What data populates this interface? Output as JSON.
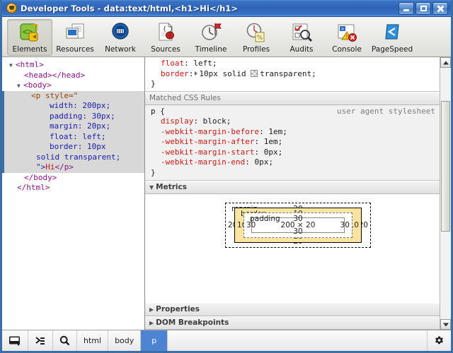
{
  "window": {
    "title": "Developer Tools - data:text/html,<h1>Hi</h1>",
    "icon": "devtools-shield-icon",
    "controls": {
      "minimize": "minimize-button",
      "maximize": "maximize-button",
      "close": "close-button"
    }
  },
  "toolbar": {
    "items": [
      {
        "label": "Elements",
        "icon": "elements-icon",
        "selected": true
      },
      {
        "label": "Resources",
        "icon": "resources-icon",
        "selected": false
      },
      {
        "label": "Network",
        "icon": "network-icon",
        "selected": false
      },
      {
        "label": "Sources",
        "icon": "sources-icon",
        "selected": false
      },
      {
        "label": "Timeline",
        "icon": "timeline-icon",
        "selected": false
      },
      {
        "label": "Profiles",
        "icon": "profiles-icon",
        "selected": false
      },
      {
        "label": "Audits",
        "icon": "audits-icon",
        "selected": false
      },
      {
        "label": "Console",
        "icon": "console-icon",
        "selected": false
      },
      {
        "label": "PageSpeed",
        "icon": "pagespeed-icon",
        "selected": false
      }
    ]
  },
  "dom_tree": {
    "rows": [
      {
        "id": "r0",
        "text": "<html>"
      },
      {
        "id": "r1",
        "text": "<head></head>"
      },
      {
        "id": "r2",
        "text": "<body>"
      },
      {
        "id": "r3",
        "text": "<p style=\""
      },
      {
        "id": "r4",
        "text": "width: 200px;"
      },
      {
        "id": "r5",
        "text": "padding: 30px;"
      },
      {
        "id": "r6",
        "text": "margin: 20px;"
      },
      {
        "id": "r7",
        "text": "float: left;"
      },
      {
        "id": "r8",
        "text": "border: 10px"
      },
      {
        "id": "r9",
        "text": "solid transparent;"
      },
      {
        "id": "r10",
        "text": "\">Hi</p>"
      },
      {
        "id": "r11",
        "text": "</body>"
      },
      {
        "id": "r12",
        "text": "</html>"
      }
    ],
    "selected_node": "p"
  },
  "style_rule": {
    "lines": [
      {
        "prop": "float",
        "value": "left;"
      },
      {
        "prop": "border",
        "value": "10px solid transparent;"
      }
    ],
    "close_brace": "}"
  },
  "matched_css_rules": {
    "header": "Matched CSS Rules",
    "selector": "p {",
    "origin": "user agent stylesheet",
    "declarations": [
      {
        "prop": "display",
        "value": "block;"
      },
      {
        "prop": "-webkit-margin-before",
        "value": "1em;"
      },
      {
        "prop": "-webkit-margin-after",
        "value": "1em;"
      },
      {
        "prop": "-webkit-margin-start",
        "value": "0px;"
      },
      {
        "prop": "-webkit-margin-end",
        "value": "0px;"
      }
    ],
    "close_brace": "}"
  },
  "metrics": {
    "header": "Metrics",
    "box_model": {
      "margin": {
        "name": "margin",
        "top": "20",
        "right": "20",
        "bottom": "20",
        "left": "20"
      },
      "border": {
        "name": "border",
        "top": "10",
        "right": "10",
        "bottom": "10",
        "left": "10"
      },
      "padding": {
        "name": "padding",
        "top": "30",
        "right": "30",
        "bottom": "30",
        "left": "30"
      },
      "content": "200 × 20"
    }
  },
  "bottom_sections": [
    {
      "label": "Properties",
      "expanded": false
    },
    {
      "label": "DOM Breakpoints",
      "expanded": false
    }
  ],
  "statusbar": {
    "dock_icon": "dock-window-icon",
    "console_icon": "console-drawer-icon",
    "search_icon": "search-icon",
    "breadcrumbs": [
      {
        "label": "html",
        "active": false
      },
      {
        "label": "body",
        "active": false
      },
      {
        "label": "p",
        "active": true
      }
    ],
    "settings_icon": "gear-icon"
  },
  "colors": {
    "title_bar": "#2f62b5",
    "selection_blue": "#4d84d1",
    "dom_selection": "#d8d8d8",
    "border_box_fill": "#fbe4a0",
    "tag_purple": "#881280",
    "attr_orange": "#994500",
    "value_blue": "#1a1aa6",
    "text_red": "#c41a16",
    "property_red": "#c41a16"
  }
}
